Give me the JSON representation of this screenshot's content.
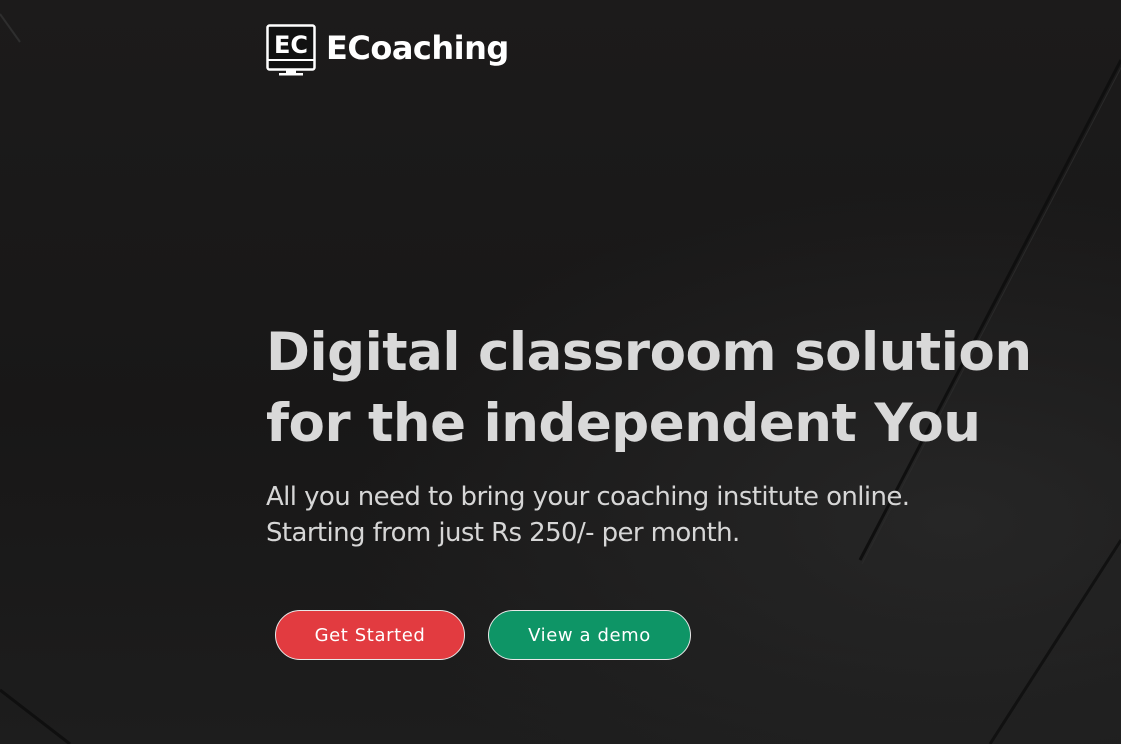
{
  "brand": {
    "logo_letters": "EC",
    "name": "ECoaching"
  },
  "hero": {
    "headline_line1": "Digital classroom solution",
    "headline_line2": "for the independent You",
    "subtitle_line1": "All you need to bring your coaching institute online.",
    "subtitle_line2": "Starting from just Rs 250/- per month."
  },
  "actions": {
    "primary_label": "Get Started",
    "secondary_label": "View a demo"
  },
  "colors": {
    "background": "#1a1a1a",
    "primary_button": "#e23b40",
    "secondary_button": "#0e9566",
    "headline": "#d9d9d9"
  },
  "icons": {
    "logo": "monitor-icon"
  }
}
